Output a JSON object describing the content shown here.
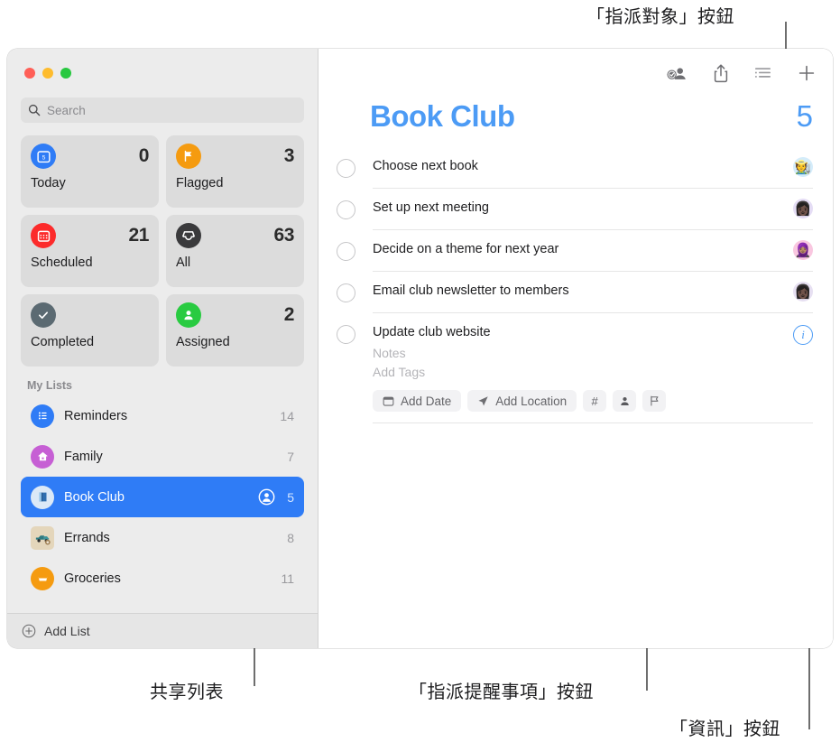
{
  "callouts": {
    "assignee": "「指派對象」按鈕",
    "shared_list": "共享列表",
    "assign_reminder": "「指派提醒事項」按鈕",
    "info": "「資訊」按鈕"
  },
  "window": {
    "traffic_lights": [
      "close",
      "minimize",
      "zoom"
    ]
  },
  "sidebar": {
    "search": {
      "placeholder": "Search",
      "value": "",
      "icon": "search-icon"
    },
    "smart_lists": [
      {
        "label": "Today",
        "count": "0",
        "icon": "today-calendar-icon",
        "icon_color": "#2f7cf6",
        "glyph": "5"
      },
      {
        "label": "Flagged",
        "count": "3",
        "icon": "flag-icon",
        "icon_color": "#f59b10",
        "glyph": "⚑"
      },
      {
        "label": "Scheduled",
        "count": "21",
        "icon": "scheduled-calendar-icon",
        "icon_color": "#fc2b2b",
        "glyph": "▦"
      },
      {
        "label": "All",
        "count": "63",
        "icon": "inbox-tray-icon",
        "icon_color": "#3a3a3c",
        "glyph": "▼"
      },
      {
        "label": "Completed",
        "count": "",
        "icon": "checkmark-icon",
        "icon_color": "#5b6a72",
        "glyph": "✓"
      },
      {
        "label": "Assigned",
        "count": "2",
        "icon": "person-icon",
        "icon_color": "#29cb41",
        "glyph": "person"
      }
    ],
    "my_lists_header": "My Lists",
    "lists": [
      {
        "name": "Reminders",
        "count": "14",
        "icon": "list-bullet-icon",
        "icon_color": "#2f7cf6",
        "shared": false,
        "selected": false
      },
      {
        "name": "Family",
        "count": "7",
        "icon": "house-icon",
        "icon_color": "#c65fd4",
        "shared": false,
        "selected": false
      },
      {
        "name": "Book Club",
        "count": "5",
        "icon": "book-icon",
        "icon_color": "#dbe9f7",
        "shared": true,
        "selected": true
      },
      {
        "name": "Errands",
        "count": "8",
        "icon": "truck-icon",
        "icon_color": "#d8c39f",
        "shared": false,
        "selected": false
      },
      {
        "name": "Groceries",
        "count": "11",
        "icon": "cart-icon",
        "icon_color": "#f59b10",
        "shared": false,
        "selected": false
      }
    ],
    "add_list_label": "Add List"
  },
  "main": {
    "toolbar": [
      {
        "name": "assignee-button",
        "icon": "person-badge-checkmark-icon"
      },
      {
        "name": "share-button",
        "icon": "share-icon"
      },
      {
        "name": "view-options-button",
        "icon": "list-sort-icon"
      },
      {
        "name": "add-reminder-button",
        "icon": "plus-icon"
      }
    ],
    "list_title": "Book Club",
    "list_total": "5",
    "tasks": [
      {
        "title": "Choose next book",
        "avatar_bg": "#d4ecfa",
        "avatar_emoji": "🧑‍🌾",
        "expanded": false
      },
      {
        "title": "Set up next meeting",
        "avatar_bg": "#e5ddf5",
        "avatar_emoji": "👩🏿",
        "expanded": false
      },
      {
        "title": "Decide on a theme for next year",
        "avatar_bg": "#f9c7e0",
        "avatar_emoji": "🧕🏽",
        "expanded": false
      },
      {
        "title": "Email club newsletter to members",
        "avatar_bg": "#e7e0f2",
        "avatar_emoji": "👩🏿",
        "expanded": false
      },
      {
        "title": "Update club website",
        "avatar_bg": "",
        "avatar_emoji": "",
        "expanded": true
      }
    ],
    "detail": {
      "notes_placeholder": "Notes",
      "tags_placeholder": "Add Tags",
      "chips": [
        {
          "label": "Add Date",
          "icon": "calendar-icon"
        },
        {
          "label": "Add Location",
          "icon": "location-arrow-icon"
        }
      ],
      "square_buttons": [
        {
          "name": "add-tag-button",
          "glyph": "#"
        },
        {
          "name": "assign-person-button",
          "glyph": "person"
        },
        {
          "name": "flag-button",
          "glyph": "flag"
        }
      ],
      "info_button_label": "i"
    }
  },
  "colors": {
    "accent": "#2f7cf6",
    "title_blue": "#4c9bf5",
    "sidebar_bg": "#ececec",
    "card_bg": "#dcdcdc"
  }
}
